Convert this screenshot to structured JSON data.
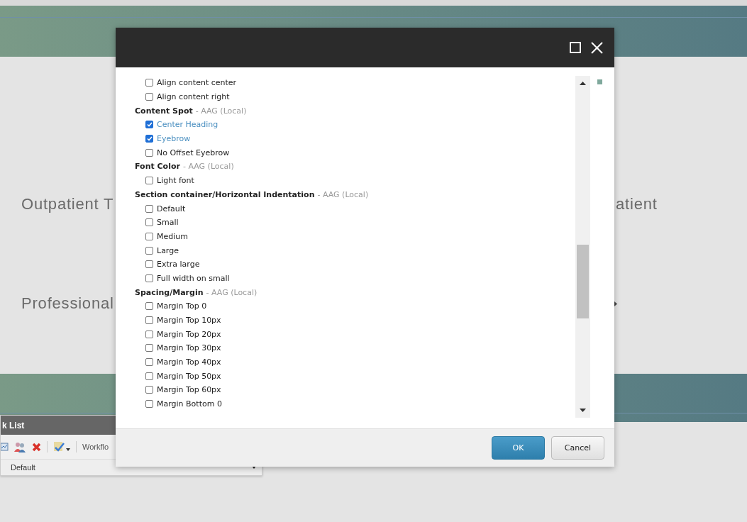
{
  "background": {
    "rows": [
      {
        "left": "Outpatient T",
        "right": "atient",
        "arrow": false
      },
      {
        "left": "Professional",
        "right": "",
        "arrow": true
      }
    ]
  },
  "task_list": {
    "title": "k List",
    "toolbar_label": "Workflo",
    "dropdown": "Default"
  },
  "dialog": {
    "groups": [
      {
        "items": [
          {
            "label": "Align content center",
            "checked": false
          },
          {
            "label": "Align content right",
            "checked": false
          }
        ]
      },
      {
        "title": "Content Spot",
        "source": "- AAG (Local)",
        "items": [
          {
            "label": "Center Heading",
            "checked": true
          },
          {
            "label": "Eyebrow",
            "checked": true
          },
          {
            "label": "No Offset Eyebrow",
            "checked": false
          }
        ]
      },
      {
        "title": "Font Color",
        "source": "- AAG (Local)",
        "items": [
          {
            "label": "Light font",
            "checked": false
          }
        ]
      },
      {
        "title": "Section container/Horizontal Indentation",
        "source": "- AAG (Local)",
        "items": [
          {
            "label": "Default",
            "checked": false
          },
          {
            "label": "Small",
            "checked": false
          },
          {
            "label": "Medium",
            "checked": false
          },
          {
            "label": "Large",
            "checked": false
          },
          {
            "label": "Extra large",
            "checked": false
          },
          {
            "label": "Full width on small",
            "checked": false
          }
        ]
      },
      {
        "title": "Spacing/Margin",
        "source": "- AAG (Local)",
        "items": [
          {
            "label": "Margin Top 0",
            "checked": false
          },
          {
            "label": "Margin Top 10px",
            "checked": false
          },
          {
            "label": "Margin Top 20px",
            "checked": false
          },
          {
            "label": "Margin Top 30px",
            "checked": false
          },
          {
            "label": "Margin Top 40px",
            "checked": false
          },
          {
            "label": "Margin Top 50px",
            "checked": false
          },
          {
            "label": "Margin Top 60px",
            "checked": false
          },
          {
            "label": "Margin Bottom 0",
            "checked": false
          }
        ]
      }
    ],
    "buttons": [
      {
        "label": "OK",
        "kind": "primary"
      },
      {
        "label": "Cancel",
        "kind": "secondary"
      }
    ]
  }
}
